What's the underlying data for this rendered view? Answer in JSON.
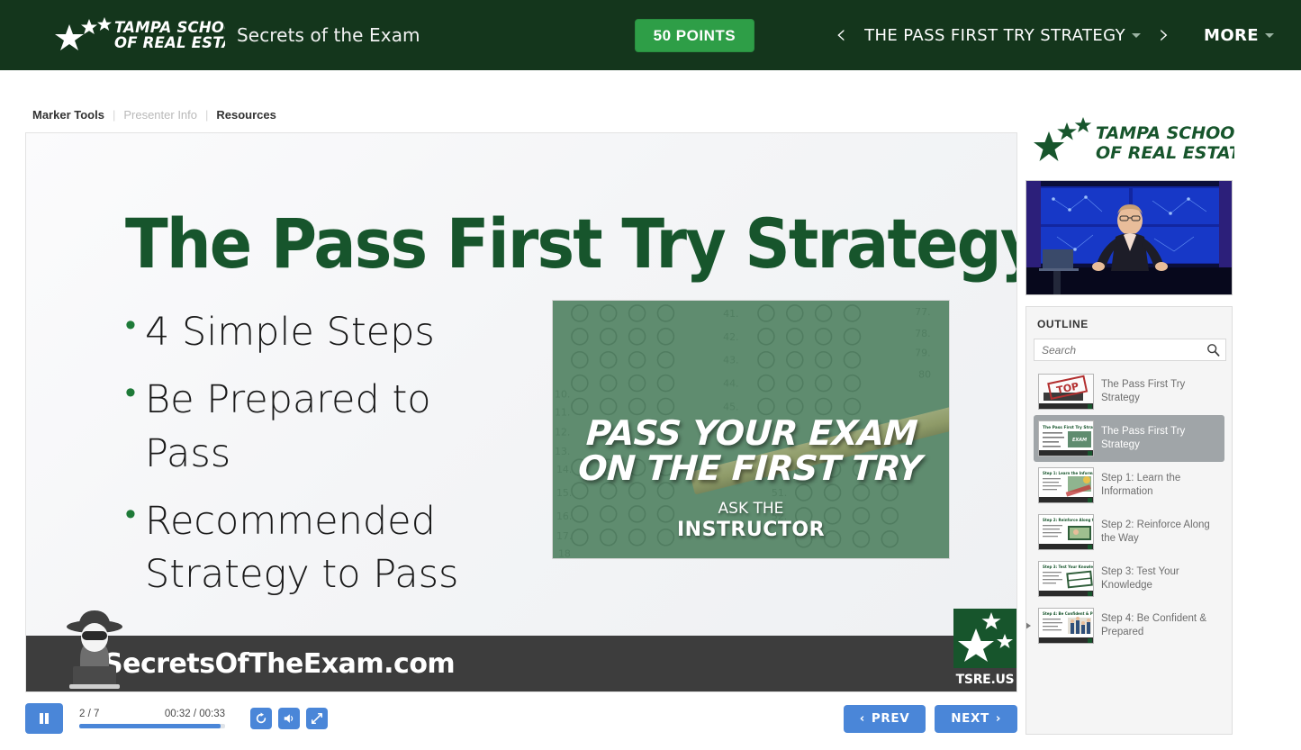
{
  "header": {
    "brand_line1": "TAMPA SCHOOL",
    "brand_line2": "OF REAL ESTATE",
    "subtitle": "Secrets of the Exam",
    "points_label": "50 POINTS",
    "prev_arrow": "‹",
    "next_arrow": "›",
    "current_module": "THE PASS FIRST TRY STRATEGY",
    "more_label": "MORE",
    "bg_color": "#14361c",
    "points_color": "#2e9e47"
  },
  "tools": {
    "marker_tools": "Marker Tools",
    "presenter_info": "Presenter Info",
    "resources": "Resources",
    "separator": "|"
  },
  "slide": {
    "title": "The Pass First Try Strategy",
    "bullets": [
      "4 Simple Steps",
      "Be Prepared to Pass",
      "Recommended Strategy to Pass"
    ],
    "image_card": {
      "headline_line1": "PASS YOUR EXAM",
      "headline_line2": "ON THE FIRST TRY",
      "sub_line1": "ASK THE",
      "sub_line2": "INSTRUCTOR",
      "bg_color": "#5f8c6f"
    },
    "watermark": "SecretsOfTheExam.com",
    "badge_label": "TSRE.US",
    "title_color": "#17552c"
  },
  "player": {
    "play_state": "pause",
    "slide_counter": "2 / 7",
    "time": "00:32 / 00:33",
    "progress_percent": 97,
    "replay_icon": "replay-icon",
    "volume_icon": "volume-icon",
    "fullscreen_icon": "fullscreen-icon",
    "prev_label": "PREV",
    "next_label": "NEXT",
    "prev_chevron": "‹",
    "next_chevron": "›",
    "accent_color": "#4a86d8"
  },
  "sidebar": {
    "logo_line1": "TAMPA SCHOOL",
    "logo_line2": "OF REAL ESTATE",
    "outline_title": "OUTLINE",
    "search_placeholder": "Search",
    "search_value": "",
    "items": [
      {
        "label": "The Pass First Try Strategy",
        "thumb": "top-secret-stamp",
        "active": false,
        "expandable": false
      },
      {
        "label": "The Pass First Try Strategy",
        "thumb": "current-slide",
        "active": true,
        "expandable": false
      },
      {
        "label": "Step 1: Learn the Information",
        "thumb": "step-1",
        "active": false,
        "expandable": false
      },
      {
        "label": "Step 2: Reinforce Along the Way",
        "thumb": "step-2",
        "active": false,
        "expandable": false
      },
      {
        "label": "Step 3: Test Your Knowledge",
        "thumb": "step-3",
        "active": false,
        "expandable": false
      },
      {
        "label": "Step 4: Be Confident & Prepared",
        "thumb": "step-4",
        "active": false,
        "expandable": true
      }
    ]
  }
}
